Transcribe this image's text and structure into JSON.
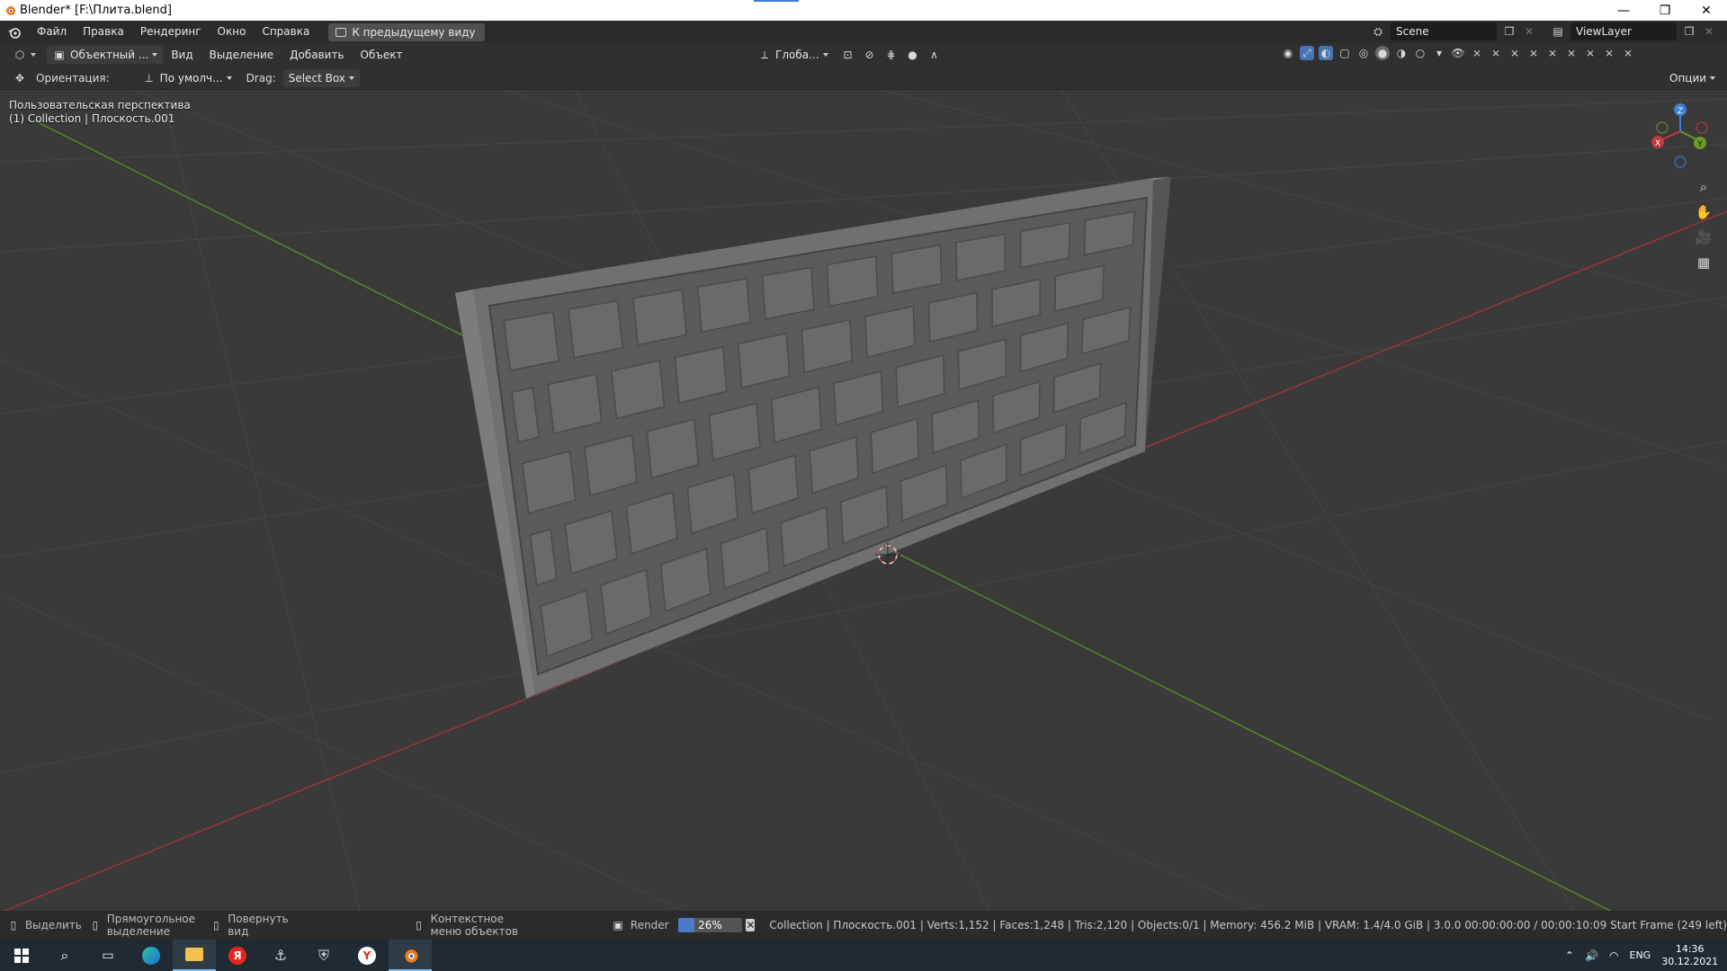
{
  "window": {
    "title": "Blender* [F:\\Плита.blend]",
    "minimize": "—",
    "maximize": "❐",
    "close": "✕"
  },
  "topbar": {
    "menus": [
      "Файл",
      "Правка",
      "Рендеринг",
      "Окно",
      "Справка"
    ],
    "workspace_tab": "К предыдущему виду",
    "scene_name": "Scene",
    "view_layer": "ViewLayer"
  },
  "view_header": {
    "mode": "Объектный ...",
    "menus": [
      "Вид",
      "Выделение",
      "Добавить",
      "Объект"
    ],
    "transform_orientation": "Глоба..."
  },
  "tool_settings": {
    "orientation_label": "Ориентация:",
    "orientation_value": "По умолч...",
    "drag_label": "Drag:",
    "drag_value": "Select Box",
    "options": "Опции"
  },
  "viewport": {
    "view_name": "Пользовательская перспектива",
    "collection_info": "(1) Collection | Плоскость.001",
    "gizmo": {
      "x": "X",
      "y": "Y",
      "z": "Z"
    },
    "colors": {
      "x_axis": "#c0393f",
      "y_axis": "#6e9a2a",
      "z_axis": "#3f7fd6",
      "object": "#6a6a6a"
    }
  },
  "statusbar": {
    "select": "Выделить",
    "box_select": "Прямоугольное выделение",
    "rotate_view": "Повернуть вид",
    "context_menu": "Контекстное меню объектов",
    "render_label": "Render",
    "render_progress_text": "26%",
    "render_progress": 0.26,
    "stats": "Collection | Плоскость.001 | Verts:1,152 | Faces:1,248 | Tris:2,120 | Objects:0/1 | Memory: 456.2 MiB | VRAM: 1.4/4.0 GiB | 3.0.0   00:00:00:00 / 00:00:10:09  Start Frame (249 left)"
  },
  "taskbar": {
    "language": "ENG",
    "time": "14:36",
    "date": "30.12.2021"
  }
}
